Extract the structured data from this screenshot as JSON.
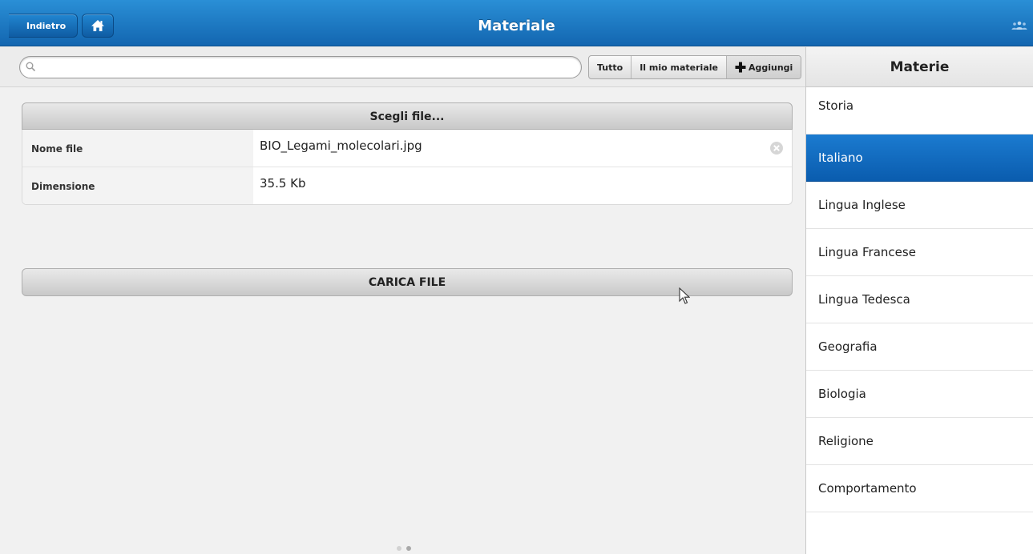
{
  "header": {
    "back_label": "Indietro",
    "title": "Materiale",
    "home_icon": "home-icon",
    "users_icon": "users-icon"
  },
  "search": {
    "value": "",
    "placeholder": ""
  },
  "filters": [
    {
      "label": "Tutto",
      "active": false
    },
    {
      "label": "Il mio materiale",
      "active": false
    },
    {
      "label": "Aggiungi",
      "active": true,
      "icon": "plus-icon"
    }
  ],
  "upload_form": {
    "choose_label": "Scegli file...",
    "rows": [
      {
        "label": "Nome file",
        "value": "BIO_Legami_molecolari.jpg"
      },
      {
        "label": "Dimensione",
        "value": "35.5 Kb"
      }
    ],
    "upload_label": "CARICA FILE"
  },
  "pager": {
    "pages": 2,
    "active_index": 1
  },
  "subjects_panel": {
    "title": "Materie",
    "items": [
      {
        "label": "Storia",
        "selected": false
      },
      {
        "label": "Italiano",
        "selected": true
      },
      {
        "label": "Lingua Inglese",
        "selected": false
      },
      {
        "label": "Lingua Francese",
        "selected": false
      },
      {
        "label": "Lingua Tedesca",
        "selected": false
      },
      {
        "label": "Geografia",
        "selected": false
      },
      {
        "label": "Biologia",
        "selected": false
      },
      {
        "label": "Religione",
        "selected": false
      },
      {
        "label": "Comportamento",
        "selected": false
      }
    ]
  },
  "colors": {
    "primary": "#1b7bd0",
    "header_top": "#2a8fd6",
    "header_bottom": "#1366b0"
  }
}
